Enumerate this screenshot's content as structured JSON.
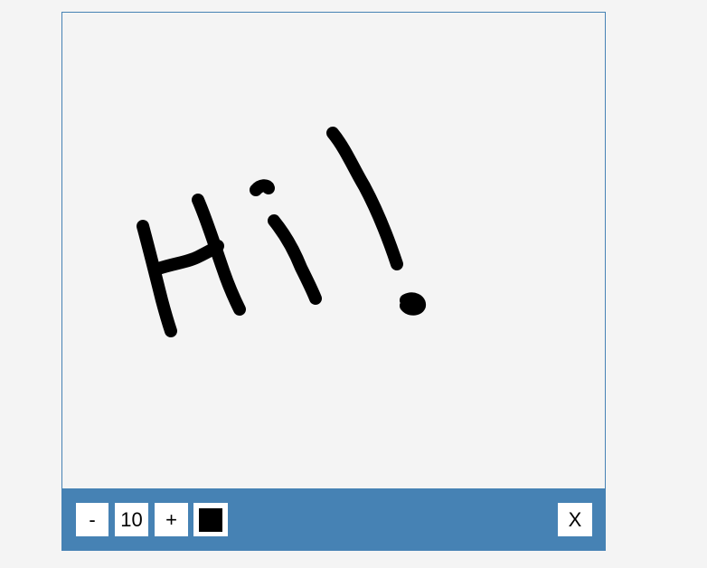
{
  "toolbar": {
    "decrease_label": "-",
    "brush_size": "10",
    "increase_label": "+",
    "close_label": "X",
    "current_color": "#000000"
  },
  "theme": {
    "accent": "#4682b4",
    "canvas_background": "#f4f4f4"
  }
}
